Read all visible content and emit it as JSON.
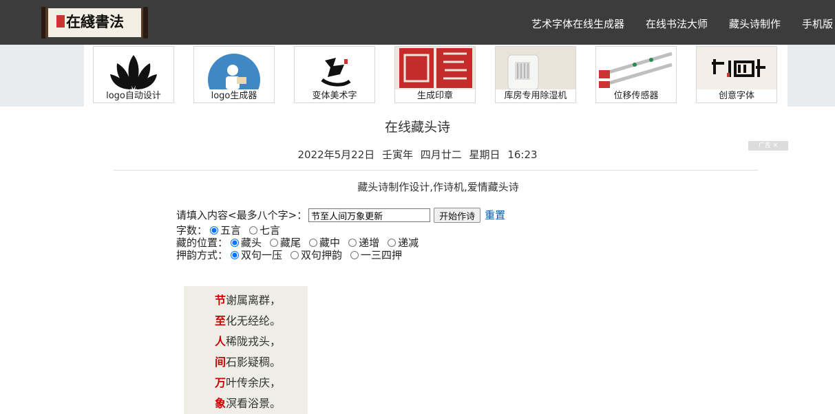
{
  "header": {
    "logo_text": "在綫書法",
    "nav": [
      "艺术字体在线生成器",
      "在线书法大师",
      "藏头诗制作",
      "手机版"
    ]
  },
  "ads": {
    "tiles": [
      "logo自动设计",
      "logo生成器",
      "变体美术字",
      "生成印章",
      "库房专用除湿机",
      "位移传感器",
      "创意字体"
    ],
    "tag": "广告 ✕"
  },
  "page": {
    "title": "在线藏头诗",
    "date": "2022年5月22日 壬寅年 四月廿二 星期日 16:23",
    "subtitle": "藏头诗制作设计,作诗机,爱情藏头诗"
  },
  "form": {
    "content_label": "请填入内容<最多八个字>：",
    "content_value": "节至人间万象更新",
    "submit_label": "开始作诗",
    "reset_label": "重置",
    "chars_label": "字数：",
    "chars_options": [
      "五言",
      "七言"
    ],
    "position_label": "藏的位置：",
    "position_options": [
      "藏头",
      "藏尾",
      "藏中",
      "递增",
      "递减"
    ],
    "rhyme_label": "押韵方式：",
    "rhyme_options": [
      "双句一压",
      "双句押韵",
      "一三四押"
    ]
  },
  "poem": {
    "lines": [
      {
        "head": "节",
        "rest": "谢属离群，"
      },
      {
        "head": "至",
        "rest": "化无经纶。"
      },
      {
        "head": "人",
        "rest": "稀陇戎头，"
      },
      {
        "head": "间",
        "rest": "石影疑稠。"
      },
      {
        "head": "万",
        "rest": "叶传余庆，"
      },
      {
        "head": "象",
        "rest": "溟看浴景。"
      }
    ]
  }
}
